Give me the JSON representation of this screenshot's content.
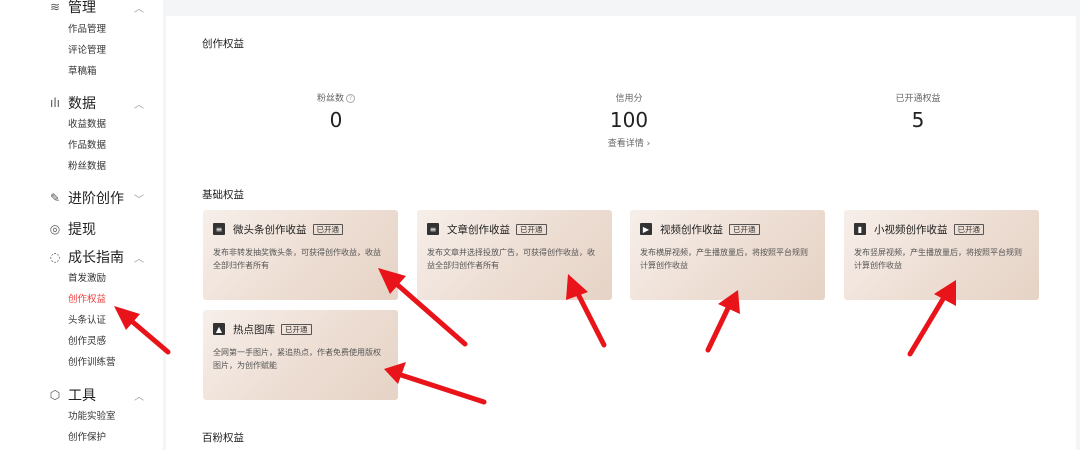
{
  "sidebar": {
    "sections": [
      {
        "label": "管理",
        "icon": "layers-icon"
      },
      {
        "label": "数据",
        "icon": "bar-chart-icon"
      },
      {
        "label": "进阶创作",
        "icon": "edit-icon"
      },
      {
        "label": "提现",
        "icon": "coin-icon"
      },
      {
        "label": "成长指南",
        "icon": "compass-icon"
      },
      {
        "label": "工具",
        "icon": "toolbox-icon"
      }
    ],
    "items": {
      "manage": [
        "作品管理",
        "评论管理",
        "草稿箱"
      ],
      "data": [
        "收益数据",
        "作品数据",
        "粉丝数据"
      ],
      "growth": [
        "首发激励",
        "创作权益",
        "头条认证",
        "创作灵感",
        "创作训练营"
      ],
      "tools": [
        "功能实验室",
        "创作保护"
      ]
    }
  },
  "main": {
    "title": "创作权益",
    "stats": [
      {
        "label": "粉丝数",
        "value": "0"
      },
      {
        "label": "信用分",
        "value": "100"
      },
      {
        "label": "已开通权益",
        "value": "5"
      }
    ],
    "details_link": "查看详情 ›",
    "basic_title": "基础权益",
    "badge": "已开通",
    "cards": [
      {
        "title": "微头条创作收益",
        "icon": "wtt-icon",
        "desc": "发布非转发抽奖微头条，可获得创作收益，收益全部归作者所有"
      },
      {
        "title": "文章创作收益",
        "icon": "article-icon",
        "desc": "发布文章并选择投放广告，可获得创作收益，收益全部归创作者所有"
      },
      {
        "title": "视频创作收益",
        "icon": "video-icon",
        "desc": "发布横屏视频，产生播放量后，将按照平台规则计算创作收益"
      },
      {
        "title": "小视频创作收益",
        "icon": "short-video-icon",
        "desc": "发布竖屏视频，产生播放量后，将按照平台规则计算创作收益"
      },
      {
        "title": "热点图库",
        "icon": "image-icon",
        "desc": "全网第一手图片，紧追热点，作者免费使用版权图片，为创作赋能"
      }
    ],
    "fans_title": "百粉权益"
  },
  "colors": {
    "accent": "#f04142",
    "card_bg": "#ecdcd1",
    "annotation": "#e8141a"
  }
}
